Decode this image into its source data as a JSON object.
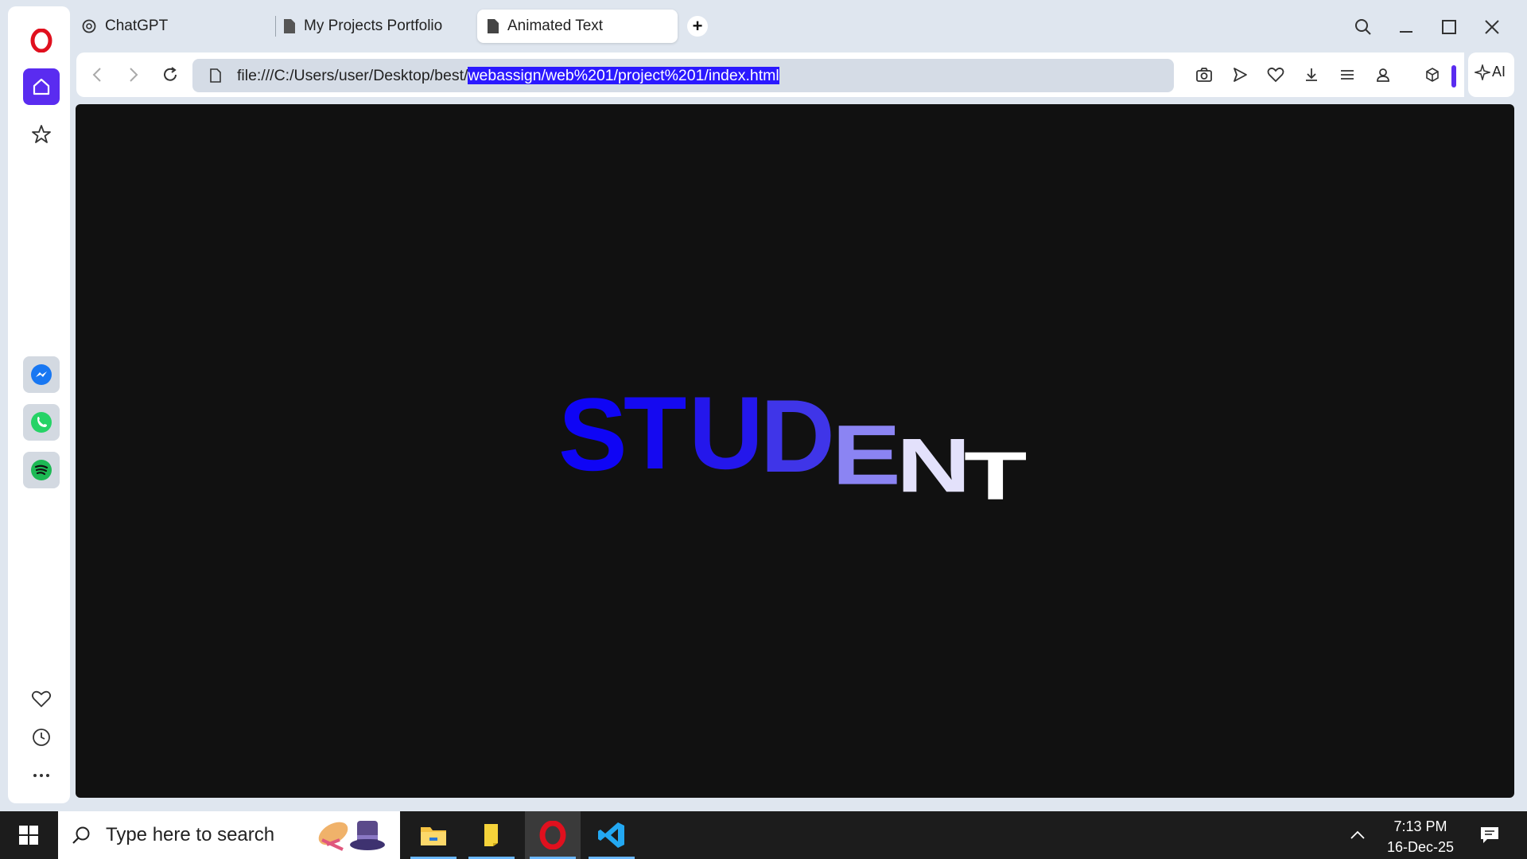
{
  "browser": {
    "tabs": [
      {
        "label": "ChatGPT",
        "icon": "chatgpt-icon",
        "active": false
      },
      {
        "label": "My Projects Portfolio",
        "icon": "document-icon",
        "active": false
      },
      {
        "label": "Animated Text",
        "icon": "document-icon",
        "active": true
      }
    ],
    "new_tab_label": "+",
    "address": {
      "url_prefix": "file:///C:/Users/user/Desktop/best/",
      "url_selected": "webassign/web%201/project%201/index.html"
    },
    "ai_label": "AI"
  },
  "page": {
    "letters": [
      "S",
      "T",
      "U",
      "D",
      "E",
      "N",
      "T"
    ],
    "letter_colors": [
      "#0f05f5",
      "#1509f0",
      "#2417eb",
      "#3f35e8",
      "#8b84f3",
      "#e3e1fb",
      "#ffffff"
    ]
  },
  "taskbar": {
    "search_placeholder": "Type here to search",
    "time": "7:13 PM",
    "date": "16-Dec-25"
  },
  "colors": {
    "accent": "#5a2cf0",
    "selection": "#2b19ff",
    "page_background": "#111111",
    "opera_red": "#e0101e"
  }
}
